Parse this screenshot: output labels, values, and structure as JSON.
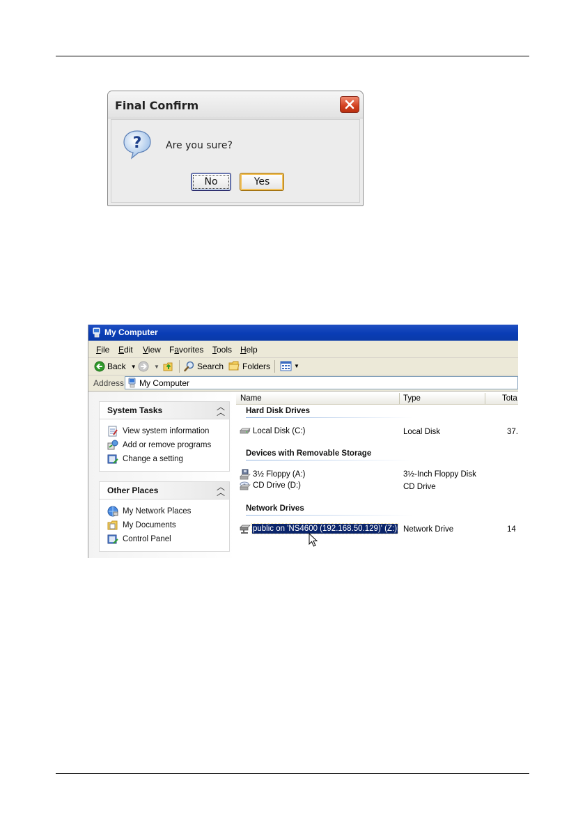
{
  "dialog": {
    "title": "Final Confirm",
    "message": "Are you sure?",
    "buttons": {
      "no": "No",
      "yes": "Yes"
    }
  },
  "window": {
    "title": "My Computer",
    "menu": [
      "File",
      "Edit",
      "View",
      "Favorites",
      "Tools",
      "Help"
    ],
    "menu_mnemonics": [
      "F",
      "E",
      "V",
      "a",
      "T",
      "H"
    ],
    "toolbar": {
      "back": "Back",
      "search": "Search",
      "folders": "Folders"
    },
    "address": {
      "label": "Address",
      "value": "My Computer"
    }
  },
  "left_pane": {
    "system_tasks": {
      "title": "System Tasks",
      "items": [
        "View system information",
        "Add or remove programs",
        "Change a setting"
      ]
    },
    "other_places": {
      "title": "Other Places",
      "items": [
        "My Network Places",
        "My Documents",
        "Control Panel"
      ]
    }
  },
  "content": {
    "columns": {
      "name": "Name",
      "type": "Type",
      "total": "Tota"
    },
    "groups": [
      {
        "title": "Hard Disk Drives"
      },
      {
        "title": "Devices with Removable Storage"
      },
      {
        "title": "Network Drives"
      }
    ],
    "drives": [
      {
        "name": "Local Disk (C:)",
        "type": "Local Disk",
        "total": "37.",
        "icon": "hard-disk-icon"
      },
      {
        "name": "3½ Floppy (A:)",
        "type": "3½-Inch Floppy Disk",
        "total": "",
        "icon": "floppy-icon"
      },
      {
        "name": "CD Drive (D:)",
        "type": "CD Drive",
        "total": "",
        "icon": "cd-drive-icon"
      },
      {
        "name": "public on 'NS4600 (192.168.50.129)' (Z:)",
        "type": "Network Drive",
        "total": "14",
        "icon": "network-drive-icon",
        "selected": true
      }
    ]
  }
}
